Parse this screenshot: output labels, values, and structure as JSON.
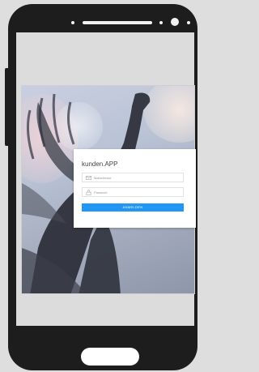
{
  "app": {
    "name": "kunden.APP"
  },
  "login": {
    "username_placeholder": "Mailadresse",
    "username_value": "",
    "username_icon": "envelope-icon",
    "password_placeholder": "Passwort",
    "password_value": "",
    "password_icon": "lock-icon",
    "submit_label": "ANMELDEN"
  },
  "colors": {
    "accent": "#2196f3",
    "phone_body": "#1d1d1d",
    "page_background": "#dedede"
  }
}
